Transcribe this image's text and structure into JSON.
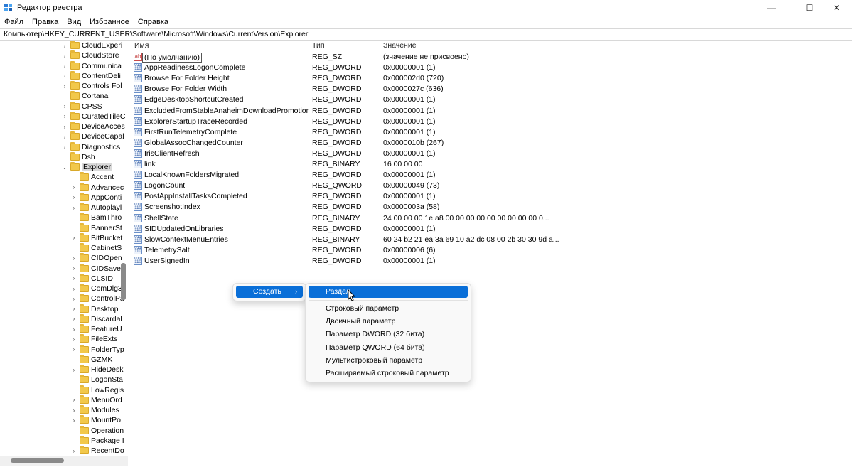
{
  "window": {
    "title": "Редактор реестра",
    "minimize": "—",
    "maximize": "☐",
    "close": "✕"
  },
  "menu": [
    "Файл",
    "Правка",
    "Вид",
    "Избранное",
    "Справка"
  ],
  "address": "Компьютер\\HKEY_CURRENT_USER\\Software\\Microsoft\\Windows\\CurrentVersion\\Explorer",
  "tree": [
    {
      "label": "CloudExperi",
      "level": 1,
      "expanded": false
    },
    {
      "label": "CloudStore",
      "level": 1,
      "expanded": false
    },
    {
      "label": "Communica",
      "level": 1,
      "expanded": false
    },
    {
      "label": "ContentDeli",
      "level": 1,
      "expanded": false
    },
    {
      "label": "Controls Fol",
      "level": 1,
      "expanded": false
    },
    {
      "label": "Cortana",
      "level": 1,
      "expanded": false,
      "nochev": true
    },
    {
      "label": "CPSS",
      "level": 1,
      "expanded": false
    },
    {
      "label": "CuratedTileC",
      "level": 1,
      "expanded": false
    },
    {
      "label": "DeviceAcces",
      "level": 1,
      "expanded": false
    },
    {
      "label": "DeviceCapal",
      "level": 1,
      "expanded": false
    },
    {
      "label": "Diagnostics",
      "level": 1,
      "expanded": false
    },
    {
      "label": "Dsh",
      "level": 1,
      "expanded": false,
      "nochev": true
    },
    {
      "label": "Explorer",
      "level": 1,
      "expanded": true,
      "selected": true
    },
    {
      "label": "Accent",
      "level": 2,
      "expanded": false,
      "nochev": true
    },
    {
      "label": "Advancec",
      "level": 2,
      "expanded": false
    },
    {
      "label": "AppConti",
      "level": 2,
      "expanded": false
    },
    {
      "label": "Autoplayl",
      "level": 2,
      "expanded": false
    },
    {
      "label": "BamThro",
      "level": 2,
      "expanded": false,
      "nochev": true
    },
    {
      "label": "BannerSt",
      "level": 2,
      "expanded": false,
      "nochev": true
    },
    {
      "label": "BitBucket",
      "level": 2,
      "expanded": false
    },
    {
      "label": "CabinetS",
      "level": 2,
      "expanded": false,
      "nochev": true
    },
    {
      "label": "CIDOpen",
      "level": 2,
      "expanded": false
    },
    {
      "label": "CIDSave",
      "level": 2,
      "expanded": false
    },
    {
      "label": "CLSID",
      "level": 2,
      "expanded": false
    },
    {
      "label": "ComDlg3",
      "level": 2,
      "expanded": false
    },
    {
      "label": "ControlPa",
      "level": 2,
      "expanded": false
    },
    {
      "label": "Desktop",
      "level": 2,
      "expanded": false
    },
    {
      "label": "Discardal",
      "level": 2,
      "expanded": false
    },
    {
      "label": "FeatureU",
      "level": 2,
      "expanded": false
    },
    {
      "label": "FileExts",
      "level": 2,
      "expanded": false
    },
    {
      "label": "FolderTyp",
      "level": 2,
      "expanded": false
    },
    {
      "label": "GZMK",
      "level": 2,
      "expanded": false,
      "nochev": true
    },
    {
      "label": "HideDesk",
      "level": 2,
      "expanded": false
    },
    {
      "label": "LogonSta",
      "level": 2,
      "expanded": false,
      "nochev": true
    },
    {
      "label": "LowRegis",
      "level": 2,
      "expanded": false,
      "nochev": true
    },
    {
      "label": "MenuOrd",
      "level": 2,
      "expanded": false
    },
    {
      "label": "Modules",
      "level": 2,
      "expanded": false
    },
    {
      "label": "MountPo",
      "level": 2,
      "expanded": false
    },
    {
      "label": "Operation",
      "level": 2,
      "expanded": false,
      "nochev": true
    },
    {
      "label": "Package I",
      "level": 2,
      "expanded": false,
      "nochev": true
    },
    {
      "label": "RecentDo",
      "level": 2,
      "expanded": false
    }
  ],
  "columns": {
    "name": "Имя",
    "type": "Тип",
    "value": "Значение"
  },
  "values": [
    {
      "name": "(По умолчанию)",
      "type": "REG_SZ",
      "value": "(значение не присвоено)",
      "icon": "ab"
    },
    {
      "name": "AppReadinessLogonComplete",
      "type": "REG_DWORD",
      "value": "0x00000001 (1)",
      "icon": "bin"
    },
    {
      "name": "Browse For Folder Height",
      "type": "REG_DWORD",
      "value": "0x000002d0 (720)",
      "icon": "bin"
    },
    {
      "name": "Browse For Folder Width",
      "type": "REG_DWORD",
      "value": "0x0000027c (636)",
      "icon": "bin"
    },
    {
      "name": "EdgeDesktopShortcutCreated",
      "type": "REG_DWORD",
      "value": "0x00000001 (1)",
      "icon": "bin"
    },
    {
      "name": "ExcludedFromStableAnaheimDownloadPromotionSL",
      "type": "REG_DWORD",
      "value": "0x00000001 (1)",
      "icon": "bin"
    },
    {
      "name": "ExplorerStartupTraceRecorded",
      "type": "REG_DWORD",
      "value": "0x00000001 (1)",
      "icon": "bin"
    },
    {
      "name": "FirstRunTelemetryComplete",
      "type": "REG_DWORD",
      "value": "0x00000001 (1)",
      "icon": "bin"
    },
    {
      "name": "GlobalAssocChangedCounter",
      "type": "REG_DWORD",
      "value": "0x0000010b (267)",
      "icon": "bin"
    },
    {
      "name": "IrisClientRefresh",
      "type": "REG_DWORD",
      "value": "0x00000001 (1)",
      "icon": "bin"
    },
    {
      "name": "link",
      "type": "REG_BINARY",
      "value": "16 00 00 00",
      "icon": "bin"
    },
    {
      "name": "LocalKnownFoldersMigrated",
      "type": "REG_DWORD",
      "value": "0x00000001 (1)",
      "icon": "bin"
    },
    {
      "name": "LogonCount",
      "type": "REG_QWORD",
      "value": "0x00000049 (73)",
      "icon": "bin"
    },
    {
      "name": "PostAppInstallTasksCompleted",
      "type": "REG_DWORD",
      "value": "0x00000001 (1)",
      "icon": "bin"
    },
    {
      "name": "ScreenshotIndex",
      "type": "REG_DWORD",
      "value": "0x0000003a (58)",
      "icon": "bin"
    },
    {
      "name": "ShellState",
      "type": "REG_BINARY",
      "value": "24 00 00 00 1e a8 00 00 00 00 00 00 00 00 00 0...",
      "icon": "bin"
    },
    {
      "name": "SIDUpdatedOnLibraries",
      "type": "REG_DWORD",
      "value": "0x00000001 (1)",
      "icon": "bin"
    },
    {
      "name": "SlowContextMenuEntries",
      "type": "REG_BINARY",
      "value": "60 24 b2 21 ea 3a 69 10 a2 dc 08 00 2b 30 30 9d a...",
      "icon": "bin"
    },
    {
      "name": "TelemetrySalt",
      "type": "REG_DWORD",
      "value": "0x00000006 (6)",
      "icon": "bin"
    },
    {
      "name": "UserSignedIn",
      "type": "REG_DWORD",
      "value": "0x00000001 (1)",
      "icon": "bin"
    }
  ],
  "context_menu": {
    "create": "Создать",
    "submenu": [
      "Раздел",
      "Строковый параметр",
      "Двоичный параметр",
      "Параметр DWORD (32 бита)",
      "Параметр QWORD (64 бита)",
      "Мультистроковый параметр",
      "Расширяемый строковый параметр"
    ]
  }
}
